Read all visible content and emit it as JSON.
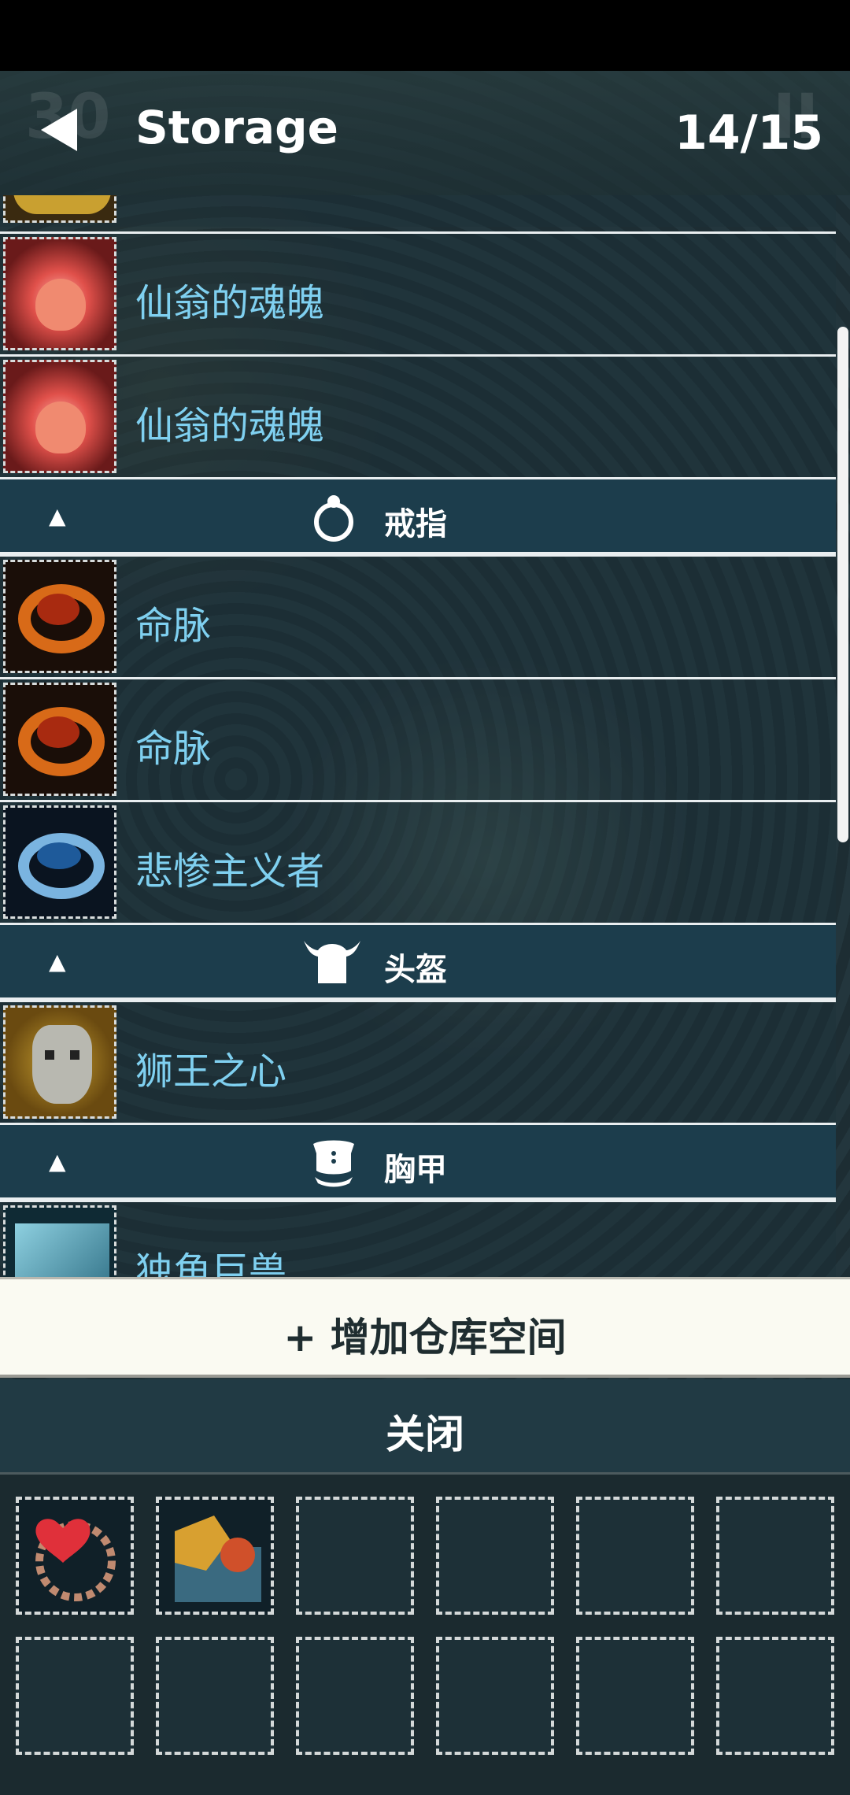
{
  "header": {
    "title": "Storage",
    "count": "14/15",
    "bg_left": "30",
    "bg_right": "II"
  },
  "list": {
    "rows": [
      {
        "name": "仙翁的魂魄",
        "icon": "soul-potion-icon"
      },
      {
        "name": "仙翁的魂魄",
        "icon": "soul-potion-icon"
      },
      {
        "name": "命脉",
        "icon": "ring-icon-orange"
      },
      {
        "name": "命脉",
        "icon": "ring-icon-orange"
      },
      {
        "name": "悲惨主义者",
        "icon": "ring-icon-blue"
      },
      {
        "name": "狮王之心",
        "icon": "helmet-mask-icon"
      },
      {
        "name": "独角巨兽",
        "icon": "armor-beast-icon"
      }
    ],
    "sections": [
      {
        "toggle": "▲",
        "label": "戒指",
        "icon": "ring-category-icon"
      },
      {
        "toggle": "▲",
        "label": "头盔",
        "icon": "helmet-category-icon"
      },
      {
        "toggle": "▲",
        "label": "胸甲",
        "icon": "chest-armor-category-icon"
      }
    ]
  },
  "buttons": {
    "add_storage": "+ 增加仓库空间",
    "close": "关闭"
  },
  "inventory": {
    "filled_slots": [
      {
        "icon": "heart-amulet-icon"
      },
      {
        "icon": "gauntlet-icon"
      }
    ],
    "total_slots": 12
  },
  "colors": {
    "item_name": "#7fd0f0",
    "section_bg": "#1c3d4c",
    "add_button_bg": "#fafaf2"
  }
}
